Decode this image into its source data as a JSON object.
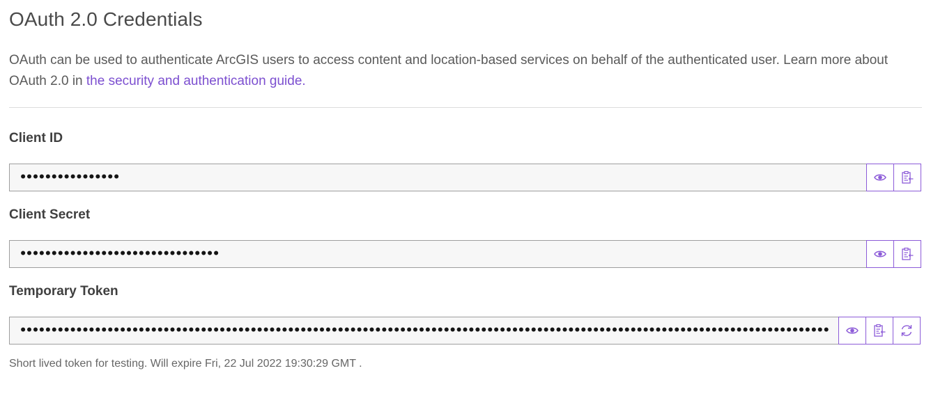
{
  "header": {
    "title": "OAuth 2.0 Credentials"
  },
  "description": {
    "text_before_link": "OAuth can be used to authenticate ArcGIS users to access content and location-based services on behalf of the authenticated user. Learn more about OAuth 2.0 in ",
    "link_text": "the security and authentication guide."
  },
  "fields": {
    "client_id": {
      "label": "Client ID",
      "value": "••••••••••••••••"
    },
    "client_secret": {
      "label": "Client Secret",
      "value": "••••••••••••••••••••••••••••••••"
    },
    "temporary_token": {
      "label": "Temporary Token",
      "value": "••••••••••••••••••••••••••••••••••••••••••••••••••••••••••••••••••••••••••••••••••••••••••••••••••••••••••••••••••••••••••••••••••••••••••••••••••••••••••••••••••••••••••••••••••••••••••••••••••••••••••••"
    }
  },
  "note": {
    "text": "Short lived token for testing. Will expire Fri, 22 Jul 2022 19:30:29 GMT ."
  },
  "icons": {
    "show": "eye-icon",
    "copy": "clipboard-copy-icon",
    "refresh": "refresh-icon"
  },
  "colors": {
    "accent": "#8c5bd8",
    "link": "#7c4fd0",
    "input_bg": "#f7f7f7",
    "input_border": "#9e9e9e"
  }
}
